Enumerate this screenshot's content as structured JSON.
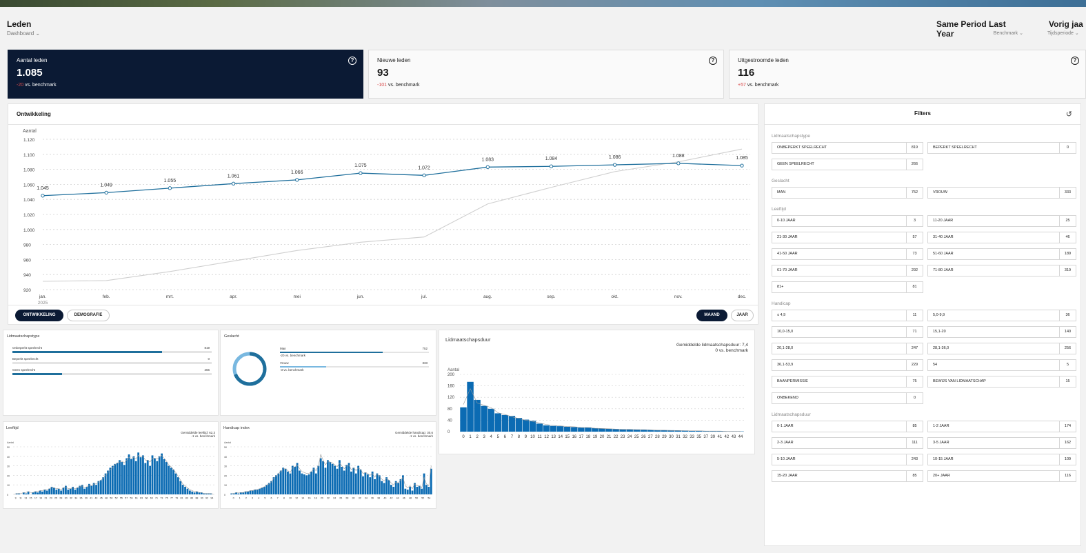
{
  "header": {
    "title": "Leden",
    "subtitle": "Dashboard ⌄",
    "benchmark_title": "Same Period Last Year",
    "benchmark_sub": "Benchmark ⌄",
    "period_title": "Vorig jaa",
    "period_sub": "Tijdsperiode ⌄"
  },
  "kpis": [
    {
      "label": "Aantal leden",
      "value": "1.085",
      "delta": "-20",
      "delta_suffix": " vs. benchmark"
    },
    {
      "label": "Nieuwe leden",
      "value": "93",
      "delta": "-101",
      "delta_suffix": " vs. benchmark"
    },
    {
      "label": "Uitgestroomde leden",
      "value": "116",
      "delta": "+57",
      "delta_suffix": " vs. benchmark"
    }
  ],
  "help_icon": "?",
  "ontwikkeling": {
    "title": "Ontwikkeling",
    "tab1": "ONTWIKKELING",
    "tab2": "DEMOGRAFIE",
    "gran1": "MAAND",
    "gran2": "JAAR"
  },
  "chart_data": [
    {
      "type": "line",
      "ylabel": "Aantal",
      "year": "2025",
      "categories": [
        "jan.",
        "feb.",
        "mrt.",
        "apr.",
        "mei",
        "jun.",
        "jul.",
        "aug.",
        "sep.",
        "okt.",
        "nov.",
        "dec."
      ],
      "ylim": [
        920,
        1120
      ],
      "yticks": [
        920,
        940,
        960,
        980,
        1000,
        1020,
        1040,
        1060,
        1080,
        1100,
        1120
      ],
      "series": [
        {
          "values": [
            1045,
            1049,
            1055,
            1061,
            1066,
            1075,
            1072,
            1083,
            1084,
            1086,
            1088,
            1085
          ],
          "labels": [
            "1.045",
            "1.049",
            "1.055",
            "1.061",
            "1.066",
            "1.075",
            "1.072",
            "1.083",
            "1.084",
            "1.086",
            "1.088",
            "1.085"
          ],
          "color": "#1f6f9c"
        },
        {
          "values": [
            931,
            932,
            944,
            958,
            972,
            983,
            990,
            1034,
            1056,
            1077,
            1090,
            1107
          ],
          "color": "#cfcfcf"
        }
      ]
    },
    {
      "type": "bar",
      "title": "Lidmaatschapsduur",
      "ylabel": "Aantal",
      "note1": "Gemiddelde lidmaatschapsduur: 7,4",
      "note2": "0 vs. benchmark",
      "ylim": [
        0,
        200
      ],
      "yticks": [
        0,
        40,
        80,
        120,
        160,
        200
      ],
      "x": [
        0,
        1,
        2,
        3,
        4,
        5,
        6,
        7,
        8,
        9,
        10,
        11,
        12,
        13,
        14,
        15,
        16,
        17,
        18,
        19,
        20,
        21,
        22,
        23,
        24,
        25,
        26,
        27,
        28,
        29,
        30,
        31,
        32,
        33,
        35,
        37,
        39,
        41,
        42,
        43,
        44
      ],
      "values": [
        85,
        174,
        111,
        90,
        80,
        64,
        58,
        55,
        48,
        42,
        38,
        28,
        22,
        20,
        19,
        17,
        16,
        14,
        15,
        12,
        11,
        10,
        9,
        8,
        8,
        7,
        6,
        6,
        5,
        5,
        5,
        4,
        4,
        3,
        3,
        2,
        2,
        2,
        1,
        1,
        1
      ],
      "bench": [
        95,
        150,
        100,
        92,
        84,
        66,
        60,
        52,
        46,
        40,
        36,
        30,
        25,
        22,
        20,
        18,
        17,
        15,
        14,
        12,
        11,
        10,
        9,
        8,
        8,
        7,
        7,
        6,
        5,
        5,
        4,
        4,
        3,
        3,
        3,
        2,
        2,
        2,
        1,
        1,
        1
      ]
    },
    {
      "type": "bar",
      "title": "Leeftijd",
      "ylabel": "Aantal",
      "note1": "Gemiddelde leeftijd: 62,3",
      "note2": "-1 vs. benchmark",
      "ylim": [
        0,
        50
      ],
      "yticks": [
        0,
        10,
        20,
        30,
        40,
        50
      ],
      "x": [
        "9",
        "11",
        "13",
        "15",
        "17",
        "19",
        "21",
        "23",
        "25",
        "28",
        "30",
        "32",
        "34",
        "36",
        "39",
        "41",
        "43",
        "45",
        "48",
        "50",
        "52",
        "55",
        "57",
        "59",
        "61",
        "63",
        "66",
        "69",
        "71",
        "73",
        "75",
        "77",
        "79",
        "81",
        "83",
        "86",
        "88",
        "90",
        "92",
        "94"
      ],
      "values": [
        0,
        1,
        1,
        0,
        2,
        1,
        3,
        0,
        2,
        3,
        2,
        4,
        3,
        5,
        4,
        6,
        8,
        7,
        5,
        6,
        4,
        7,
        9,
        5,
        6,
        8,
        5,
        7,
        9,
        10,
        6,
        8,
        11,
        9,
        12,
        10,
        14,
        15,
        18,
        22,
        25,
        28,
        30,
        32,
        33,
        36,
        34,
        31,
        38,
        42,
        37,
        40,
        35,
        44,
        39,
        41,
        33,
        36,
        30,
        41,
        38,
        35,
        40,
        43,
        37,
        34,
        30,
        28,
        26,
        22,
        18,
        14,
        10,
        8,
        6,
        4,
        3,
        2,
        3,
        2,
        2,
        1,
        1,
        1,
        1,
        0
      ],
      "bench": [
        0,
        1,
        1,
        1,
        2,
        2,
        3,
        2,
        2,
        3,
        3,
        4,
        4,
        5,
        5,
        6,
        7,
        7,
        6,
        6,
        5,
        7,
        8,
        6,
        6,
        7,
        6,
        7,
        8,
        9,
        7,
        8,
        10,
        9,
        11,
        11,
        13,
        15,
        17,
        20,
        23,
        26,
        28,
        31,
        33,
        34,
        35,
        33,
        36,
        39,
        38,
        39,
        37,
        41,
        40,
        40,
        36,
        36,
        34,
        38,
        38,
        37,
        39,
        41,
        38,
        35,
        31,
        29,
        26,
        23,
        19,
        15,
        11,
        9,
        7,
        5,
        4,
        3,
        3,
        2,
        2,
        1,
        1,
        1,
        1,
        0
      ]
    },
    {
      "type": "bar",
      "title": "Handicap index",
      "ylabel": "Aantal",
      "note1": "Gemiddelde handicap: 30,6",
      "note2": "-1 vs. benchmark",
      "ylim": [
        0,
        50
      ],
      "yticks": [
        0,
        10,
        20,
        30,
        40,
        50
      ],
      "x": [
        "0",
        "1",
        "2",
        "3",
        "4",
        "5",
        "6",
        "7",
        "8",
        "10",
        "12",
        "14",
        "16",
        "18",
        "20",
        "22",
        "24",
        "26",
        "28",
        "30",
        "32",
        "34",
        "36",
        "38",
        "40",
        "42",
        "44",
        "46",
        "48",
        "50",
        "52",
        "54"
      ],
      "values": [
        1,
        1,
        2,
        1,
        2,
        2,
        3,
        3,
        4,
        4,
        5,
        5,
        6,
        7,
        8,
        10,
        12,
        14,
        18,
        20,
        22,
        25,
        28,
        27,
        24,
        22,
        30,
        29,
        33,
        25,
        22,
        21,
        20,
        21,
        24,
        28,
        22,
        30,
        38,
        35,
        28,
        36,
        34,
        32,
        30,
        27,
        36,
        29,
        25,
        31,
        33,
        24,
        28,
        22,
        30,
        26,
        19,
        23,
        21,
        18,
        24,
        16,
        22,
        20,
        14,
        12,
        18,
        15,
        10,
        8,
        14,
        12,
        16,
        20,
        6,
        5,
        8,
        4,
        12,
        8,
        9,
        6,
        22,
        10,
        8,
        27
      ],
      "bench": [
        1,
        1,
        2,
        2,
        2,
        2,
        3,
        3,
        4,
        4,
        5,
        5,
        6,
        7,
        8,
        10,
        11,
        13,
        17,
        19,
        22,
        24,
        27,
        27,
        25,
        23,
        28,
        29,
        31,
        27,
        24,
        23,
        22,
        22,
        24,
        27,
        25,
        30,
        42,
        36,
        31,
        35,
        34,
        33,
        31,
        29,
        33,
        30,
        27,
        30,
        31,
        26,
        28,
        25,
        28,
        26,
        22,
        23,
        22,
        20,
        22,
        18,
        21,
        19,
        16,
        14,
        17,
        15,
        12,
        10,
        13,
        12,
        15,
        18,
        9,
        7,
        9,
        6,
        11,
        9,
        9,
        7,
        18,
        11,
        9,
        30
      ]
    }
  ],
  "lidmaatschapstype": {
    "title": "Lidmaatschapstype",
    "rows": [
      {
        "label": "Onbeperkt speelrecht",
        "value": "819",
        "frac": 0.75
      },
      {
        "label": "Beperkt speelrecht",
        "value": "0",
        "frac": 0
      },
      {
        "label": "Geen speelrecht",
        "value": "266",
        "frac": 0.25
      }
    ]
  },
  "geslacht": {
    "title": "Geslacht",
    "man_frac": 0.69,
    "rows": [
      {
        "label": "Man",
        "value": "752",
        "sub": "-20 vs. benchmark",
        "frac": 0.69,
        "color": "#1f6f9c"
      },
      {
        "label": "Vrouw",
        "value": "333",
        "sub": "-3 vs. benchmark",
        "frac": 0.31,
        "color": "#79b8e0"
      }
    ]
  },
  "filters": {
    "title": "Filters",
    "reset_icon": "↺",
    "sections": [
      {
        "title": "Lidmaatschapstype",
        "items": [
          {
            "label": "ONBEPERKT SPEELRECHT",
            "count": "819"
          },
          {
            "label": "BEPERKT SPEELRECHT",
            "count": "0"
          },
          {
            "label": "GEEN SPEELRECHT",
            "count": "266"
          }
        ]
      },
      {
        "title": "Geslacht",
        "items": [
          {
            "label": "MAN",
            "count": "752"
          },
          {
            "label": "VROUW",
            "count": "333"
          }
        ]
      },
      {
        "title": "Leeftijd",
        "items": [
          {
            "label": "0-10 JAAR",
            "count": "3"
          },
          {
            "label": "11-20 JAAR",
            "count": "25"
          },
          {
            "label": "21-30 JAAR",
            "count": "57"
          },
          {
            "label": "31-40 JAAR",
            "count": "46"
          },
          {
            "label": "41-50 JAAR",
            "count": "73"
          },
          {
            "label": "51-60 JAAR",
            "count": "189"
          },
          {
            "label": "61-70 JAAR",
            "count": "292"
          },
          {
            "label": "71-80 JAAR",
            "count": "319"
          },
          {
            "label": "81+",
            "count": "81"
          }
        ]
      },
      {
        "title": "Handicap",
        "items": [
          {
            "label": "≤ 4,9",
            "count": "11"
          },
          {
            "label": "5,0-9,9",
            "count": "36"
          },
          {
            "label": "10,0-15,0",
            "count": "71"
          },
          {
            "label": "15,1-20",
            "count": "140"
          },
          {
            "label": "20,1-28,0",
            "count": "247"
          },
          {
            "label": "28,1-36,0",
            "count": "256"
          },
          {
            "label": "36,1-53,9",
            "count": "229"
          },
          {
            "label": "54",
            "count": "5"
          },
          {
            "label": "BAANPERMISSIE",
            "count": "75"
          },
          {
            "label": "BEWIJS VAN LIDMAATSCHAP",
            "count": "15"
          },
          {
            "label": "ONBEKEND",
            "count": "0"
          }
        ]
      },
      {
        "title": "Lidmaatschapsduur",
        "items": [
          {
            "label": "0-1 JAAR",
            "count": "85"
          },
          {
            "label": "1-2 JAAR",
            "count": "174"
          },
          {
            "label": "2-3 JAAR",
            "count": "111"
          },
          {
            "label": "3-5 JAAR",
            "count": "162"
          },
          {
            "label": "5-10 JAAR",
            "count": "243"
          },
          {
            "label": "10-15 JAAR",
            "count": "109"
          },
          {
            "label": "15-20 JAAR",
            "count": "85"
          },
          {
            "label": "20+ JAAR",
            "count": "116"
          }
        ]
      }
    ]
  }
}
